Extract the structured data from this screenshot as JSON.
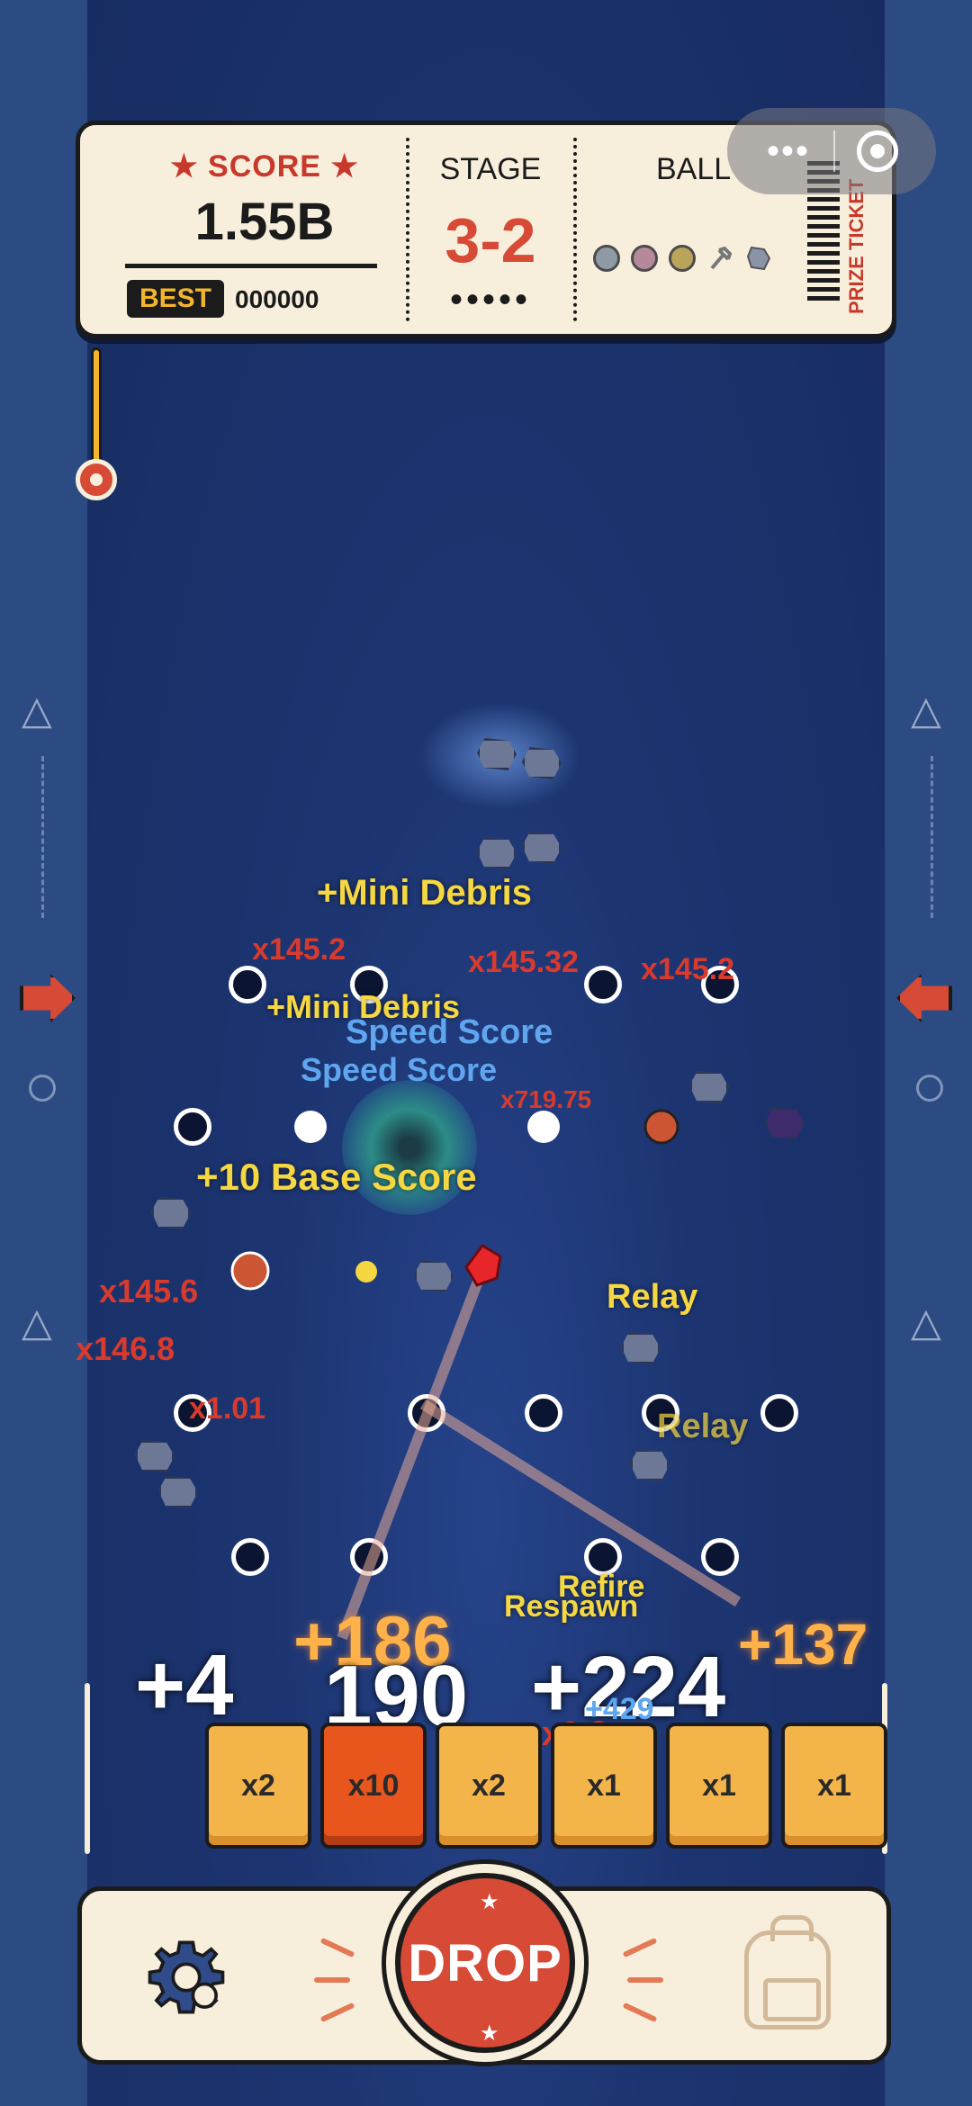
{
  "ticket": {
    "score_label": "★ SCORE ★",
    "score_value": "1.55B",
    "best_label": "BEST",
    "best_value": "000000",
    "stage_label": "STAGE",
    "stage_value": "3-2",
    "stage_dots": "•••••",
    "ball_label": "BALL",
    "prize_label": "PRIZE TICKET",
    "ball_colors": [
      "#8f9aa6",
      "#b6899a",
      "#b9a45a"
    ]
  },
  "capsule": {
    "menu": "•••"
  },
  "floating_texts": [
    {
      "text": "+Mini Debris",
      "cls": "yellow",
      "size": 40
    },
    {
      "text": "x145.2",
      "cls": "red",
      "size": 34
    },
    {
      "text": "x145.32",
      "cls": "red",
      "size": 34
    },
    {
      "text": "x145.2",
      "cls": "red",
      "size": 34
    },
    {
      "text": "+Mini Debris",
      "cls": "yellow",
      "size": 36
    },
    {
      "text": "Speed Score",
      "cls": "blue",
      "size": 38
    },
    {
      "text": "Speed Score",
      "cls": "blue",
      "size": 36
    },
    {
      "text": "x719.75",
      "cls": "red",
      "size": 28
    },
    {
      "text": "+10 Base Score",
      "cls": "yellow",
      "size": 42
    },
    {
      "text": "Relay",
      "cls": "yellow",
      "size": 38
    },
    {
      "text": "x145.6",
      "cls": "red",
      "size": 36
    },
    {
      "text": "x146.8",
      "cls": "red",
      "size": 36
    },
    {
      "text": "x1.01",
      "cls": "red",
      "size": 34
    },
    {
      "text": "Relay",
      "cls": "yellow",
      "size": 38
    },
    {
      "text": "Refire",
      "cls": "yellow",
      "size": 34
    },
    {
      "text": "Respawn",
      "cls": "yellow",
      "size": 34
    },
    {
      "text": "+186",
      "cls": "orange",
      "size": 78
    },
    {
      "text": "+137",
      "cls": "orange",
      "size": 64
    },
    {
      "text": "+4",
      "cls": "white",
      "size": 96
    },
    {
      "text": "190",
      "cls": "white",
      "size": 96
    },
    {
      "text": "+224",
      "cls": "white",
      "size": 96
    },
    {
      "text": "x0.2",
      "cls": "red",
      "size": 38
    },
    {
      "text": "+429",
      "cls": "blue",
      "size": 34
    }
  ],
  "slots": [
    {
      "label": "x2",
      "hot": false
    },
    {
      "label": "x10",
      "hot": true
    },
    {
      "label": "x2",
      "hot": false
    },
    {
      "label": "x1",
      "hot": false
    },
    {
      "label": "x1",
      "hot": false
    },
    {
      "label": "x1",
      "hot": false
    }
  ],
  "controls": {
    "drop_label": "DROP",
    "settings_icon": "gear-icon",
    "bag_icon": "backpack-icon"
  },
  "colors": {
    "accent_red": "#d64a36",
    "ticket_bg": "#f7efdc",
    "board_bg": "#1c3470",
    "slot_orange": "#f3b44a",
    "slot_hot": "#e8561e"
  }
}
